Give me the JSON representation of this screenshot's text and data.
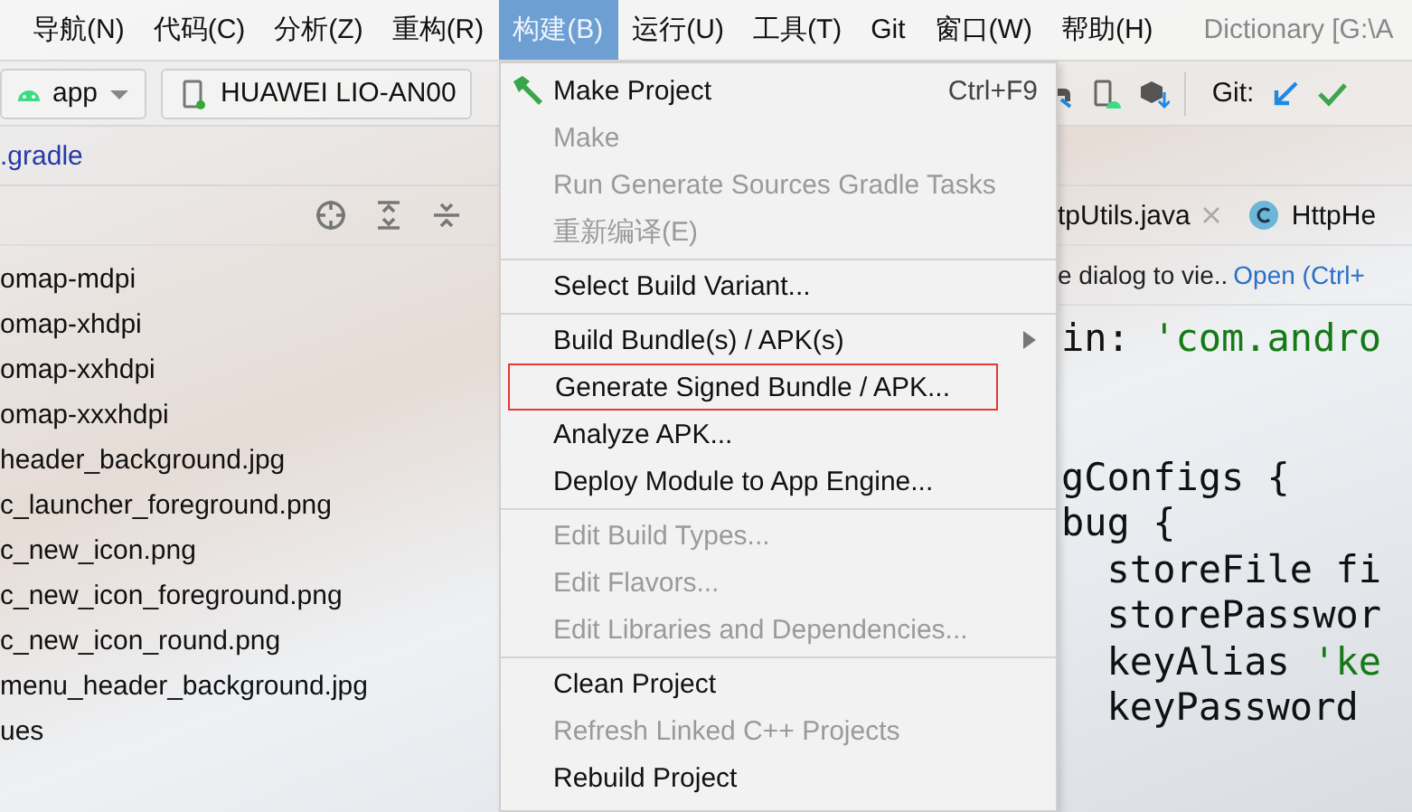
{
  "menubar": {
    "items": [
      {
        "label": "导航(N)",
        "selected": false
      },
      {
        "label": "代码(C)",
        "selected": false
      },
      {
        "label": "分析(Z)",
        "selected": false
      },
      {
        "label": "重构(R)",
        "selected": false
      },
      {
        "label": "构建(B)",
        "selected": true
      },
      {
        "label": "运行(U)",
        "selected": false
      },
      {
        "label": "工具(T)",
        "selected": false
      },
      {
        "label": "Git",
        "selected": false
      },
      {
        "label": "窗口(W)",
        "selected": false
      },
      {
        "label": "帮助(H)",
        "selected": false
      }
    ],
    "title": "Dictionary [G:\\A"
  },
  "toolbar": {
    "config": "app",
    "device": "HUAWEI LIO-AN00",
    "git_label": "Git:"
  },
  "breadcrumb": ".gradle",
  "project_tree": {
    "items": [
      "omap-mdpi",
      "omap-xhdpi",
      "omap-xxhdpi",
      "omap-xxxhdpi",
      "header_background.jpg",
      "c_launcher_foreground.png",
      "c_new_icon.png",
      "c_new_icon_foreground.png",
      "c_new_icon_round.png",
      "menu_header_background.jpg",
      "ues"
    ]
  },
  "editor": {
    "tabs": [
      {
        "label": "tpUtils.java",
        "closable": true,
        "kind": "plain"
      },
      {
        "label": "HttpHe",
        "closable": false,
        "kind": "class"
      }
    ],
    "notification": {
      "text": "e dialog to vie..",
      "link": "Open (Ctrl+"
    },
    "lines": [
      {
        "kind": "code",
        "segments": [
          {
            "text": "in: ",
            "kind": "plain"
          },
          {
            "text": "'com.andro",
            "kind": "string"
          }
        ]
      },
      {
        "kind": "blank"
      },
      {
        "kind": "blank"
      },
      {
        "kind": "code",
        "segments": [
          {
            "text": "gConfigs {",
            "kind": "plain"
          }
        ]
      },
      {
        "kind": "code",
        "segments": [
          {
            "text": "bug {",
            "kind": "plain"
          }
        ]
      },
      {
        "kind": "code",
        "segments": [
          {
            "text": "  storeFile fi",
            "kind": "plain"
          }
        ]
      },
      {
        "kind": "code",
        "segments": [
          {
            "text": "  storePasswor",
            "kind": "plain"
          }
        ]
      },
      {
        "kind": "code",
        "segments": [
          {
            "text": "  keyAlias ",
            "kind": "plain"
          },
          {
            "text": "'ke",
            "kind": "string"
          }
        ]
      },
      {
        "kind": "code",
        "segments": [
          {
            "text": "  keyPassword",
            "kind": "plain"
          }
        ]
      }
    ]
  },
  "build_menu": {
    "items": [
      {
        "kind": "item",
        "label": "Make Project",
        "shortcut": "Ctrl+F9",
        "disabled": false,
        "icon": true
      },
      {
        "kind": "item",
        "label": "Make",
        "disabled": true
      },
      {
        "kind": "item",
        "label": "Run Generate Sources Gradle Tasks",
        "disabled": true
      },
      {
        "kind": "item",
        "label": "重新编译(E)",
        "disabled": true
      },
      {
        "kind": "separator"
      },
      {
        "kind": "item",
        "label": "Select Build Variant...",
        "disabled": false
      },
      {
        "kind": "separator"
      },
      {
        "kind": "item",
        "label": "Build Bundle(s) / APK(s)",
        "disabled": false,
        "submenu": true
      },
      {
        "kind": "item",
        "label": "Generate Signed Bundle / APK...",
        "disabled": false,
        "outlined": true
      },
      {
        "kind": "item",
        "label": "Analyze APK...",
        "disabled": false
      },
      {
        "kind": "item",
        "label": "Deploy Module to App Engine...",
        "disabled": false
      },
      {
        "kind": "separator"
      },
      {
        "kind": "item",
        "label": "Edit Build Types...",
        "disabled": true
      },
      {
        "kind": "item",
        "label": "Edit Flavors...",
        "disabled": true
      },
      {
        "kind": "item",
        "label": "Edit Libraries and Dependencies...",
        "disabled": true
      },
      {
        "kind": "separator"
      },
      {
        "kind": "item",
        "label": "Clean Project",
        "disabled": false
      },
      {
        "kind": "item",
        "label": "Refresh Linked C++ Projects",
        "disabled": true
      },
      {
        "kind": "item",
        "label": "Rebuild Project",
        "disabled": false
      }
    ]
  }
}
